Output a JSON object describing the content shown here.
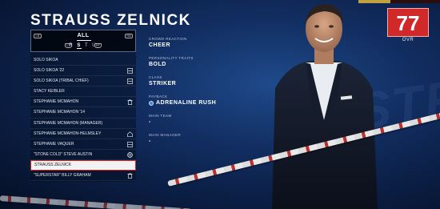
{
  "superstar": {
    "name": "STRAUSS ZELNICK",
    "ovr_value": "77",
    "ovr_label": "OVR"
  },
  "filter": {
    "label": "ALL",
    "letters": [
      "R",
      "S",
      "T",
      "U"
    ],
    "active_letter": "S"
  },
  "roster": [
    {
      "name": "SOLO SIKOA",
      "icon": ""
    },
    {
      "name": "SOLO SIKOA '22",
      "icon": "title-belt-icon"
    },
    {
      "name": "SOLO SIKOA (TRIBAL CHIEF)",
      "icon": "title-belt-icon"
    },
    {
      "name": "STACY KEIBLER",
      "icon": ""
    },
    {
      "name": "STEPHANIE MCMAHON",
      "icon": "trash-icon"
    },
    {
      "name": "STEPHANIE MCMAHON '14",
      "icon": ""
    },
    {
      "name": "STEPHANIE MCMAHON (MANAGER)",
      "icon": ""
    },
    {
      "name": "STEPHANIE MCMAHON-HELMSLEY",
      "icon": "house-icon"
    },
    {
      "name": "STEPHANIE VAQUER",
      "icon": "title-belt-icon"
    },
    {
      "name": "\"STONE COLD\" STEVE AUSTIN",
      "icon": "globe-icon"
    },
    {
      "name": "STRAUSS ZELNICK",
      "icon": "",
      "selected": true
    },
    {
      "name": "\"SUPERSTAR\" BILLY GRAHAM",
      "icon": "trash-icon"
    }
  ],
  "details": {
    "crowd_reaction_label": "CROWD REACTION",
    "crowd_reaction_value": "CHEER",
    "personality_traits_label": "PERSONALITY TRAITS",
    "personality_traits_value": "BOLD",
    "class_label": "CLASS",
    "class_value": "STRIKER",
    "payback_label": "PAYBACK",
    "payback_value": "ADRENALINE RUSH",
    "payback_icon": "adrenaline-rush-icon",
    "main_team_label": "MAIN TEAM",
    "main_team_value": "-",
    "main_manager_label": "MAIN MANAGER",
    "main_manager_value": "-"
  },
  "colors": {
    "ovr_red": "#d1282a",
    "selected_row_border": "#dd2222",
    "background_blue": "#122f63"
  }
}
